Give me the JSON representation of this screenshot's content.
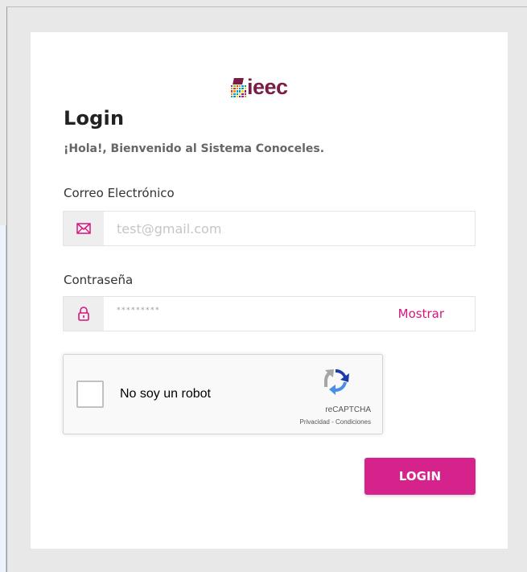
{
  "logo": {
    "text": "ieec"
  },
  "login": {
    "title": "Login",
    "subtitle": "¡Hola!, Bienvenido al Sistema Conoceles."
  },
  "email": {
    "label": "Correo Electrónico",
    "placeholder": "test@gmail.com",
    "value": "",
    "icon": "envelope-icon"
  },
  "password": {
    "label": "Contraseña",
    "masked_value": "*********",
    "show_label": "Mostrar",
    "icon": "lock-icon"
  },
  "captcha": {
    "label": "No soy un robot",
    "checked": false,
    "brand": "reCAPTCHA",
    "links": "Privacidad - Condiciones"
  },
  "buttons": {
    "login": "LOGIN"
  },
  "colors": {
    "accent": "#d6157e",
    "button": "#d6238c",
    "brand": "#7b1c45",
    "background": "#e8e8e8"
  }
}
